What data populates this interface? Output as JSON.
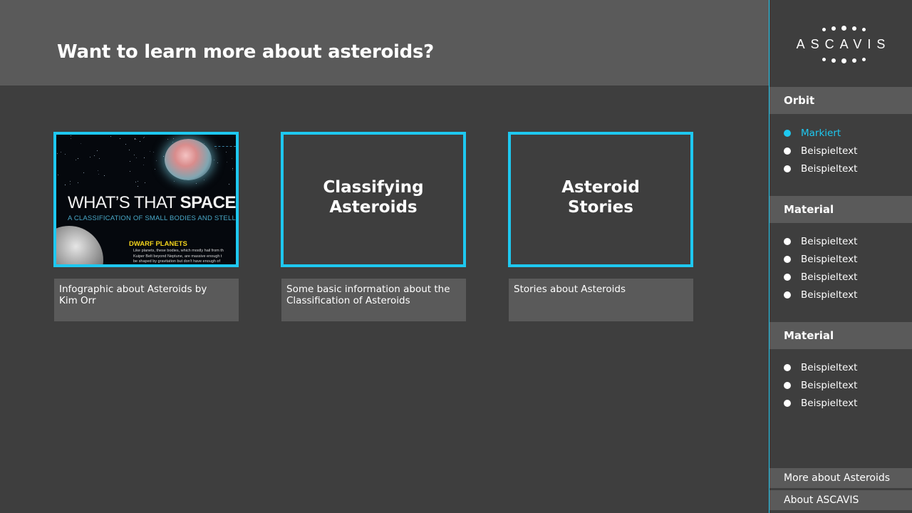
{
  "header": {
    "title": "Want to learn more about asteroids?"
  },
  "cards": [
    {
      "image": {
        "headline_light": "WHAT’S THAT ",
        "headline_bold": "SPACE RO",
        "subtitle": "A CLASSIFICATION OF SMALL BODIES AND STELLAR",
        "section": "DWARF PLANETS",
        "body": "Like planets, these bodies, which mostly hail from th\nKuiper Belt beyond Neptune, are massive enough t\nbe shaped by gravitation but don’t have enough of"
      },
      "caption": "Infographic about Asteroids by\nKim Orr"
    },
    {
      "title": "Classifying\nAsteroids",
      "caption": "Some basic information about the\nClassification of Asteroids"
    },
    {
      "title": "Asteroid\nStories",
      "caption": "Stories about Asteroids"
    }
  ],
  "sidebar": {
    "logo": "ASCAVIS",
    "sections": [
      {
        "title": "Orbit",
        "items": [
          {
            "label": "Markiert",
            "active": true
          },
          {
            "label": "Beispieltext",
            "active": false
          },
          {
            "label": "Beispieltext",
            "active": false
          }
        ]
      },
      {
        "title": "Material",
        "items": [
          {
            "label": "Beispieltext",
            "active": false
          },
          {
            "label": "Beispieltext",
            "active": false
          },
          {
            "label": "Beispieltext",
            "active": false
          },
          {
            "label": "Beispieltext",
            "active": false
          }
        ]
      },
      {
        "title": "Material",
        "items": [
          {
            "label": "Beispieltext",
            "active": false
          },
          {
            "label": "Beispieltext",
            "active": false
          },
          {
            "label": "Beispieltext",
            "active": false
          }
        ]
      }
    ],
    "footer_links": [
      "More about Asteroids",
      "About ASCAVIS"
    ]
  },
  "colors": {
    "accent": "#1ec8f0",
    "background": "#3e3e3e",
    "panel": "#5a5a5a",
    "text": "#ffffff"
  }
}
